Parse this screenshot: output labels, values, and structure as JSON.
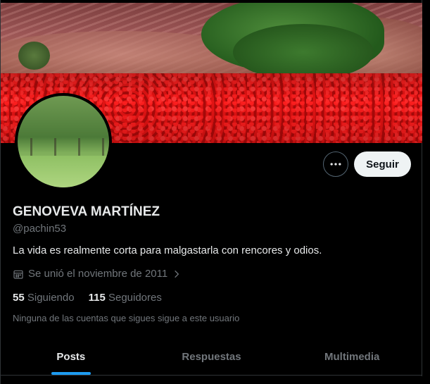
{
  "profile": {
    "name": "GENOVEVA MARTÍNEZ",
    "handle": "@pachin53",
    "bio": "La vida es realmente corta para malgastarla con rencores y odios.",
    "joined": "Se unió el noviembre de 2011",
    "following_count": "55",
    "following_label": "Siguiendo",
    "followers_count": "115",
    "followers_label": "Seguidores",
    "mutuals_note": "Ninguna de las cuentas que sigues sigue a este usuario"
  },
  "actions": {
    "more_icon": "ellipsis-icon",
    "follow_label": "Seguir"
  },
  "tabs": [
    {
      "label": "Posts",
      "active": true
    },
    {
      "label": "Respuestas",
      "active": false
    },
    {
      "label": "Multimedia",
      "active": false
    }
  ],
  "colors": {
    "background": "#000000",
    "text_primary": "#e7e9ea",
    "text_secondary": "#71767b",
    "accent": "#1d9bf0",
    "follow_button_bg": "#eff3f4"
  }
}
